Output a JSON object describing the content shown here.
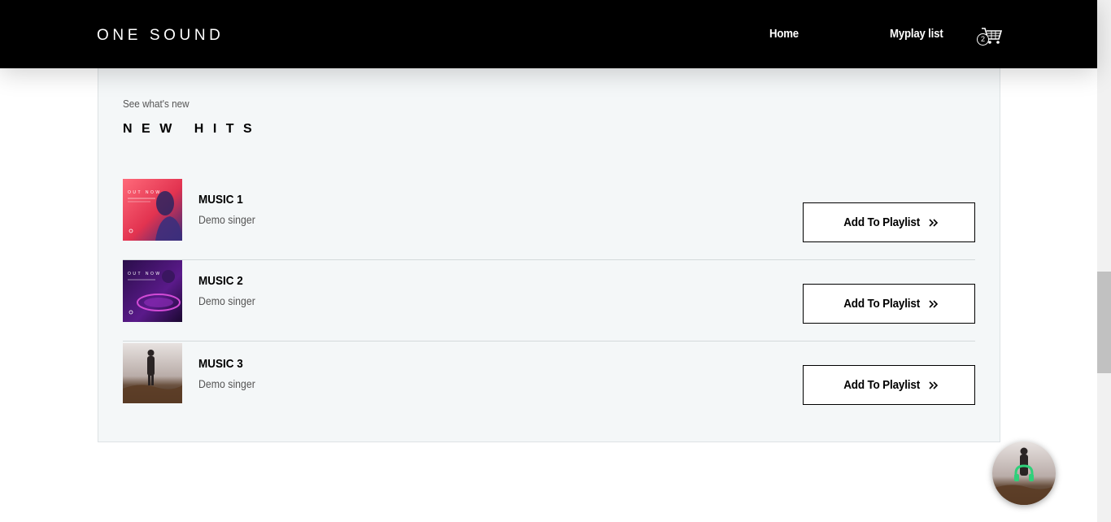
{
  "header": {
    "logo": "ONE SOUND",
    "nav": {
      "home": "Home",
      "playlist": "Myplay list"
    },
    "cart_count": "2",
    "cart_icon": "cart-icon"
  },
  "section": {
    "eyebrow": "See what's new",
    "title": "NEW HITS"
  },
  "tracks": [
    {
      "title": "MUSIC 1",
      "artist": "Demo singer",
      "button": "Add To Playlist",
      "cover_caption": "OUT NOW"
    },
    {
      "title": "MUSIC 2",
      "artist": "Demo singer",
      "button": "Add To Playlist",
      "cover_caption": "OUT NOW"
    },
    {
      "title": "MUSIC 3",
      "artist": "Demo singer",
      "button": "Add To Playlist"
    }
  ],
  "colors": {
    "header_bg": "#000000",
    "card_bg": "#f4f7f8",
    "accent_green": "#2fd07a"
  }
}
